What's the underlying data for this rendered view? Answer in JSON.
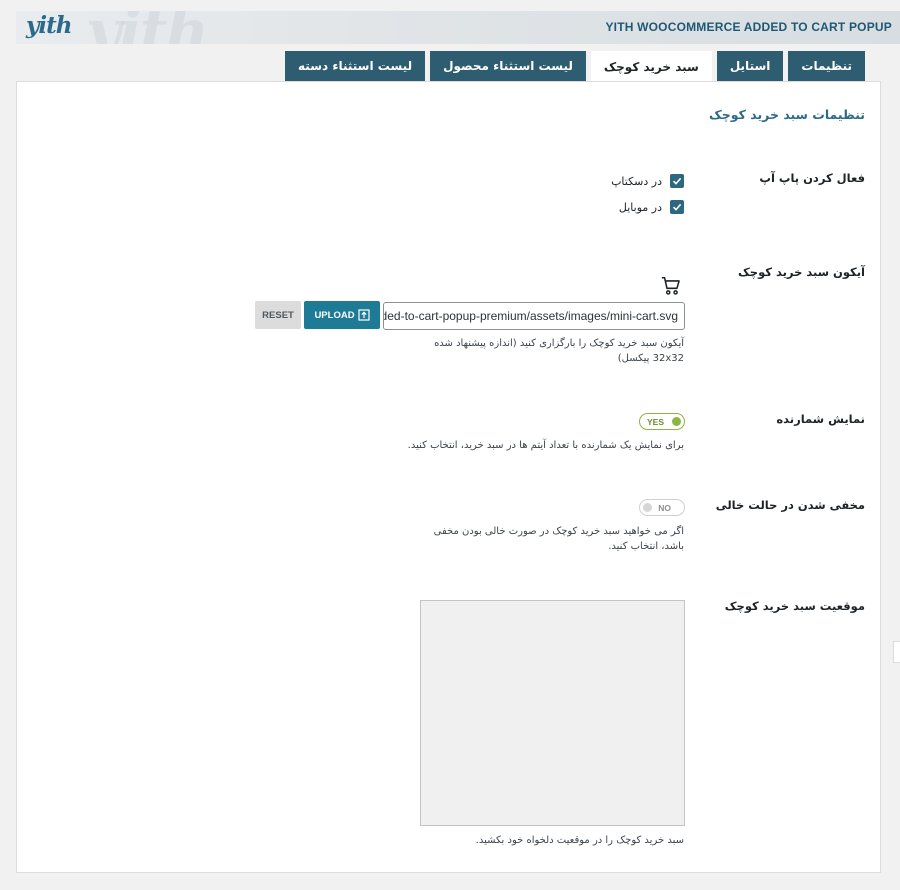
{
  "header": {
    "logo": "yith",
    "title": "YITH WOOCOMMERCE ADDED TO CART POPUP"
  },
  "tabs": [
    {
      "label": "تنظیمات",
      "active": false
    },
    {
      "label": "استایل",
      "active": false
    },
    {
      "label": "سبد خرید کوچک",
      "active": true
    },
    {
      "label": "لیست استثناء محصول",
      "active": false
    },
    {
      "label": "لیست استثناء دسته",
      "active": false
    }
  ],
  "section_title": "تنظیمات سبد خرید کوچک",
  "enable_popup": {
    "label": "فعال کردن پاپ آپ",
    "desktop": {
      "label": "در دسکتاپ",
      "checked": true
    },
    "mobile": {
      "label": "در موبایل",
      "checked": true
    }
  },
  "mini_cart_icon": {
    "label": "آیکون سبد خرید کوچک",
    "icon": "cart-icon",
    "value": "yith-woocommerce-added-to-cart-popup-premium/assets/images/mini-cart.svg",
    "upload_label": "UPLOAD",
    "reset_label": "RESET",
    "description": "آیکون سبد خرید کوچک را بارگزاری کنید (اندازه پیشنهاد شده 32x32 پیکسل)"
  },
  "show_counter": {
    "label": "نمایش شمارنده",
    "toggle": "YES",
    "description": "برای نمایش یک شمارنده با تعداد آیتم ها در سبد خرید، انتخاب کنید."
  },
  "hide_empty": {
    "label": "مخفی شدن در حالت خالی",
    "toggle": "NO",
    "description": "اگر می خواهید سبد خرید کوچک در صورت خالی بودن مخفی باشد، انتخاب کنید."
  },
  "mini_cart_position": {
    "label": "موقعیت سبد خرید کوچک",
    "description": "سبد خرید کوچک را در موقعیت دلخواه خود بکشید."
  },
  "colors": {
    "accent": "#2e5d71",
    "upload_button": "#1e7b96",
    "toggle_on": "#8db542",
    "title": "#2c6a8b"
  }
}
